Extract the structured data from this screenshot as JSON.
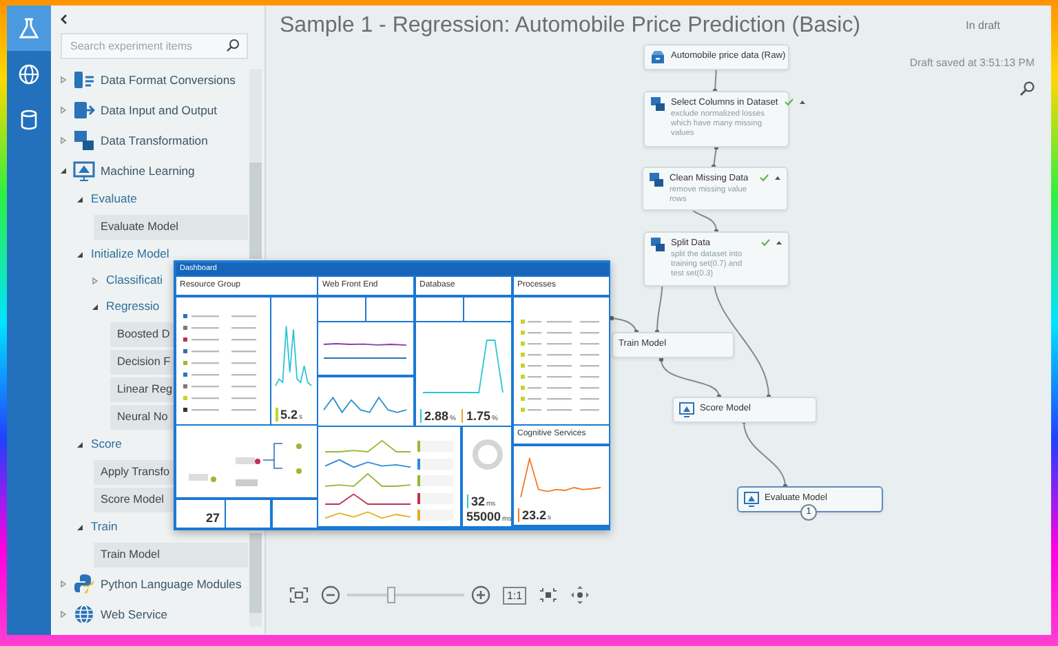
{
  "icon_bar": {
    "items": [
      {
        "selected": true
      },
      {
        "selected": false
      },
      {
        "selected": false
      }
    ]
  },
  "sidebar": {
    "search": {
      "placeholder": "Search experiment items"
    },
    "tree": [
      {
        "kind": "category",
        "label": "Data Format Conversions",
        "expanded": false
      },
      {
        "kind": "category",
        "label": "Data Input and Output",
        "expanded": false
      },
      {
        "kind": "category",
        "label": "Data Transformation",
        "expanded": false
      },
      {
        "kind": "category",
        "label": "Machine Learning",
        "expanded": true,
        "children": [
          {
            "kind": "group",
            "label": "Evaluate",
            "expanded": true,
            "children": [
              {
                "kind": "module",
                "label": "Evaluate Model"
              }
            ]
          },
          {
            "kind": "group",
            "label": "Initialize Model",
            "expanded": true,
            "children": [
              {
                "kind": "group",
                "label": "Classificati",
                "expanded": false
              },
              {
                "kind": "group",
                "label": "Regressio",
                "expanded": true,
                "children": [
                  {
                    "kind": "module",
                    "label": "Boosted D"
                  },
                  {
                    "kind": "module",
                    "label": "Decision F"
                  },
                  {
                    "kind": "module",
                    "label": "Linear Reg"
                  },
                  {
                    "kind": "module",
                    "label": "Neural No"
                  }
                ]
              }
            ]
          },
          {
            "kind": "group",
            "label": "Score",
            "expanded": true,
            "children": [
              {
                "kind": "module",
                "label": "Apply Transfo"
              },
              {
                "kind": "module",
                "label": "Score Model"
              }
            ]
          },
          {
            "kind": "group",
            "label": "Train",
            "expanded": true,
            "children": [
              {
                "kind": "module",
                "label": "Train Model"
              }
            ]
          }
        ]
      },
      {
        "kind": "category",
        "label": "Python Language Modules",
        "expanded": false
      },
      {
        "kind": "category",
        "label": "Web Service",
        "expanded": false
      }
    ]
  },
  "canvas": {
    "title": "Sample 1 - Regression: Automobile Price Prediction (Basic)",
    "status": "In draft",
    "saved": "Draft saved at 3:51:13 PM",
    "nodes": [
      {
        "kind": "dataset",
        "title": "Automobile price data (Raw)",
        "completed": false,
        "selected": false
      },
      {
        "kind": "transform",
        "title": "Select Columns in Dataset",
        "description": "exclude normalized losses which have many missing values",
        "completed": true,
        "selected": false
      },
      {
        "kind": "transform",
        "title": "Clean Missing Data",
        "description": "remove missing value rows",
        "completed": true,
        "selected": false
      },
      {
        "kind": "transform",
        "title": "Split Data",
        "description": "split the dataset into training set(0.7) and test set(0.3)",
        "completed": true,
        "selected": false
      },
      {
        "title": "Train Model",
        "completed": false,
        "selected": false
      },
      {
        "kind": "model",
        "title": "Score Model",
        "completed": false,
        "selected": false
      },
      {
        "kind": "model",
        "title": "Evaluate Model",
        "completed": false,
        "selected": true,
        "badge": "1"
      }
    ],
    "zoom_slider": {
      "level": 0.38
    },
    "actual_size": "1:1"
  },
  "dashboard": {
    "title": "Dashboard",
    "tiles": [
      {
        "title": "Resource Group"
      },
      {
        "title": "Web Front End"
      },
      {
        "title": "Database"
      },
      {
        "title": "Processes"
      },
      {
        "title": "Cognitive Services"
      }
    ],
    "metrics": [
      {
        "value": "5.2",
        "unit": "s",
        "color": "#c8d32a"
      },
      {
        "value": "2.88",
        "unit": "%",
        "color": "#2ec4d6"
      },
      {
        "value": "1.75",
        "unit": "%",
        "color": "#f0a030"
      },
      {
        "value": "27"
      },
      {
        "value": "32",
        "unit": "ms",
        "color": "#2ec4d6"
      },
      {
        "value": "55000",
        "unit": "ms"
      },
      {
        "value": "23.2",
        "unit": "s",
        "color": "#f07a20"
      }
    ]
  }
}
